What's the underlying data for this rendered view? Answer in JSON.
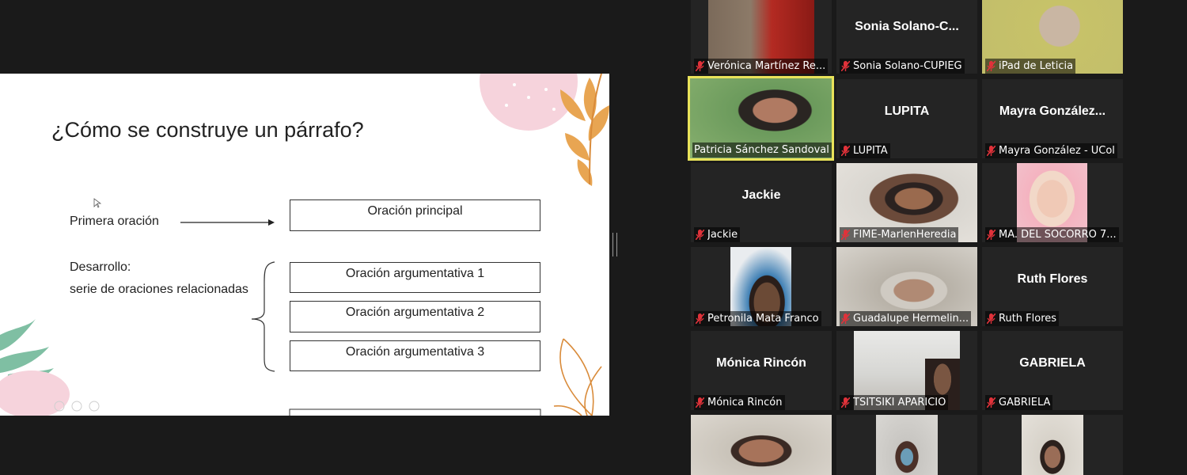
{
  "slide": {
    "title": "¿Cómo se construye un párrafo?",
    "first_sentence_label": "Primera oración",
    "development_label": "Desarrollo:",
    "development_sub": "serie de oraciones relacionadas",
    "boxes": [
      "Oración principal",
      "Oración argumentativa 1",
      "Oración argumentativa 2",
      "Oración argumentativa 3"
    ]
  },
  "participants": [
    {
      "label": "Verónica Martínez Re...",
      "big": ""
    },
    {
      "label": "Sonia Solano-CUPIEG",
      "big": "Sonia  Solano-C..."
    },
    {
      "label": "iPad de Leticia",
      "big": ""
    },
    {
      "label": "Patricia Sánchez Sandoval",
      "big": ""
    },
    {
      "label": "LUPITA",
      "big": "LUPITA"
    },
    {
      "label": "Mayra González - UCol",
      "big": "Mayra  González..."
    },
    {
      "label": "Jackie",
      "big": "Jackie"
    },
    {
      "label": "FIME-MarlenHeredia",
      "big": ""
    },
    {
      "label": "MA. DEL SOCORRO 7...",
      "big": ""
    },
    {
      "label": "Petronila Mata Franco",
      "big": ""
    },
    {
      "label": "Guadalupe Hermelin...",
      "big": ""
    },
    {
      "label": "Ruth Flores",
      "big": "Ruth Flores"
    },
    {
      "label": "Mónica Rincón",
      "big": "Mónica Rincón"
    },
    {
      "label": "TSITSIKI APARICIO",
      "big": ""
    },
    {
      "label": "GABRIELA",
      "big": "GABRIELA"
    }
  ],
  "colors": {
    "active_speaker": "#e9e35a",
    "mic_muted": "#e0323a",
    "tile_bg": "#242424"
  }
}
